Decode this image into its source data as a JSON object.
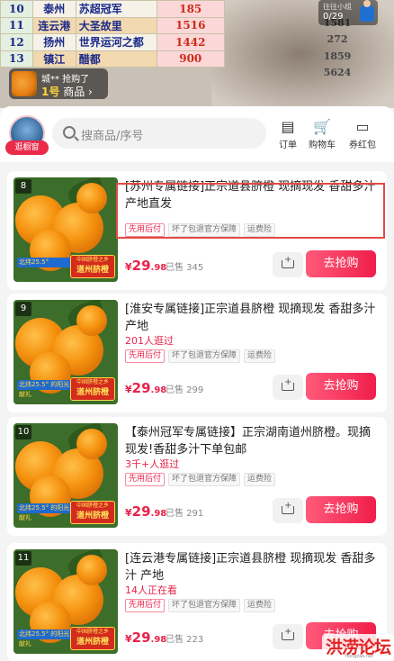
{
  "live": {
    "sheet_rows": [
      {
        "no": "10",
        "city": "泰州",
        "team": "苏超冠军",
        "value": "185",
        "right": ""
      },
      {
        "no": "11",
        "city": "连云港",
        "team": "大圣故里",
        "value": "1516",
        "right": "1581"
      },
      {
        "no": "12",
        "city": "扬州",
        "team": "世界运河之都",
        "value": "1442",
        "right": "272"
      },
      {
        "no": "13",
        "city": "镇江",
        "team": "醋都",
        "value": "900",
        "right": "1859"
      }
    ],
    "bottom_right_value": "5624",
    "counter_top": "往往小组",
    "counter_value": "0/29",
    "ticker_line1": "城** 抢购了",
    "ticker_num": "1号",
    "ticker_suffix": "商品"
  },
  "shop": {
    "avatar_label": "逛橱窗",
    "search_placeholder": "搜商品/序号",
    "buttons": [
      {
        "icon": "order-icon",
        "glyph": "▤",
        "label": "订单"
      },
      {
        "icon": "cart-icon",
        "glyph": "🛒",
        "label": "购物车"
      },
      {
        "icon": "coupon-icon",
        "glyph": "▭",
        "label": "券红包"
      }
    ]
  },
  "products": [
    {
      "index": "8",
      "title": "[苏州专属链接]正宗道县脐橙 现摘现发 香甜多汁 产地直发",
      "subtitle": "",
      "tags": [
        {
          "text": "先用后付",
          "style": "red"
        },
        {
          "text": "坏了包退官方保障",
          "style": "gray"
        },
        {
          "text": "运费险",
          "style": "gray"
        }
      ],
      "price_symbol": "¥",
      "price_int": "29",
      "price_dec": ".98",
      "sold": "已售 345",
      "buy_label": "去抢购",
      "img_left": "北纬25.5°",
      "img_right_top": "中国脐橙之乡",
      "img_right_bottom": "道州脐橙"
    },
    {
      "index": "9",
      "title": "[淮安专属链接]正宗道县脐橙 现摘现发 香甜多汁 产地",
      "subtitle": "201人逛过",
      "tags": [
        {
          "text": "先用后付",
          "style": "red"
        },
        {
          "text": "坏了包退官方保障",
          "style": "gray"
        },
        {
          "text": "运费险",
          "style": "gray"
        }
      ],
      "price_symbol": "¥",
      "price_int": "29",
      "price_dec": ".98",
      "sold": "已售 299",
      "buy_label": "去抢购",
      "img_left": "北纬25.5° 的阳光献礼",
      "img_right_top": "中国脐橙之乡",
      "img_right_bottom": "道州脐橙"
    },
    {
      "index": "10",
      "title": "【泰州冠军专属链接】正宗湖南道州脐橙。现摘现发!香甜多汁下单包邮",
      "subtitle": "3千+人逛过",
      "tags": [
        {
          "text": "先用后付",
          "style": "red"
        },
        {
          "text": "坏了包退官方保障",
          "style": "gray"
        },
        {
          "text": "运费险",
          "style": "gray"
        }
      ],
      "price_symbol": "¥",
      "price_int": "29",
      "price_dec": ".98",
      "sold": "已售 291",
      "buy_label": "去抢购",
      "img_left": "北纬25.5° 的阳光献礼",
      "img_right_top": "中国脐橙之乡",
      "img_right_bottom": "道州脐橙"
    },
    {
      "index": "11",
      "title": "[连云港专属链接]正宗道县脐橙 现摘现发 香甜多汁 产地",
      "subtitle": "14人正在看",
      "tags": [
        {
          "text": "先用后付",
          "style": "red"
        },
        {
          "text": "坏了包退官方保障",
          "style": "gray"
        },
        {
          "text": "运费险",
          "style": "gray"
        }
      ],
      "price_symbol": "¥",
      "price_int": "29",
      "price_dec": ".98",
      "sold": "已售 223",
      "buy_label": "去抢购",
      "img_left": "北纬25.5° 的阳光献礼",
      "img_right_top": "中国脐橙之乡",
      "img_right_bottom": "道州脐橙"
    }
  ],
  "watermark": {
    "glyphs": "洪涝论坛",
    "site": "hongzao.net"
  },
  "colors": {
    "accent": "#ef1e4a",
    "price": "#e8234a",
    "highlight": "#e24a44"
  }
}
